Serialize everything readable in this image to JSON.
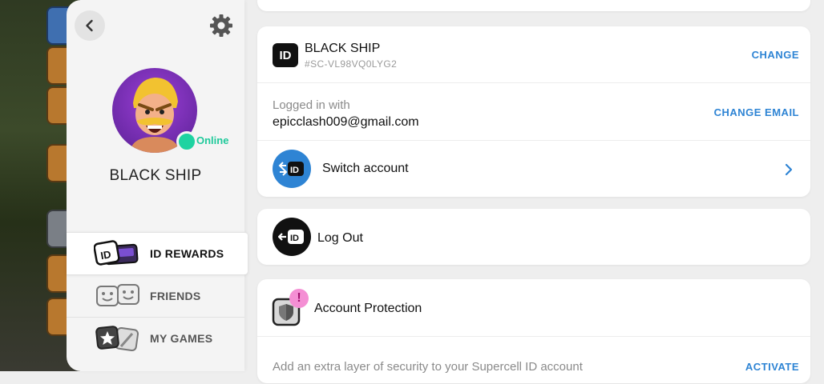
{
  "sidebar": {
    "online_status": "Online",
    "player_name": "BLACK SHIP",
    "menu": [
      {
        "label": "ID REWARDS",
        "active": true
      },
      {
        "label": "FRIENDS",
        "active": false
      },
      {
        "label": "MY GAMES",
        "active": false
      }
    ]
  },
  "account": {
    "id_badge": "ID",
    "name": "BLACK SHIP",
    "tag": "#SC-VL98VQ0LYG2",
    "change_label": "CHANGE"
  },
  "login": {
    "caption": "Logged in with",
    "email": "epicclash009@gmail.com",
    "change_email_label": "CHANGE EMAIL"
  },
  "switch_account": {
    "label": "Switch account",
    "icon_color": "#2e84d4"
  },
  "logout": {
    "label": "Log Out"
  },
  "protection": {
    "title": "Account Protection",
    "badge": "!",
    "description": "Add an extra layer of security to your Supercell ID account",
    "activate_label": "ACTIVATE"
  },
  "colors": {
    "accent": "#2e84d4",
    "online": "#1ed3a1",
    "alert_badge": "#f48fd4"
  },
  "icons": [
    "back-arrow-icon",
    "gear-icon",
    "id-icon",
    "switch-account-icon",
    "logout-icon",
    "shield-icon",
    "chevron-right-icon",
    "id-rewards-icon",
    "friends-icon",
    "my-games-icon"
  ]
}
